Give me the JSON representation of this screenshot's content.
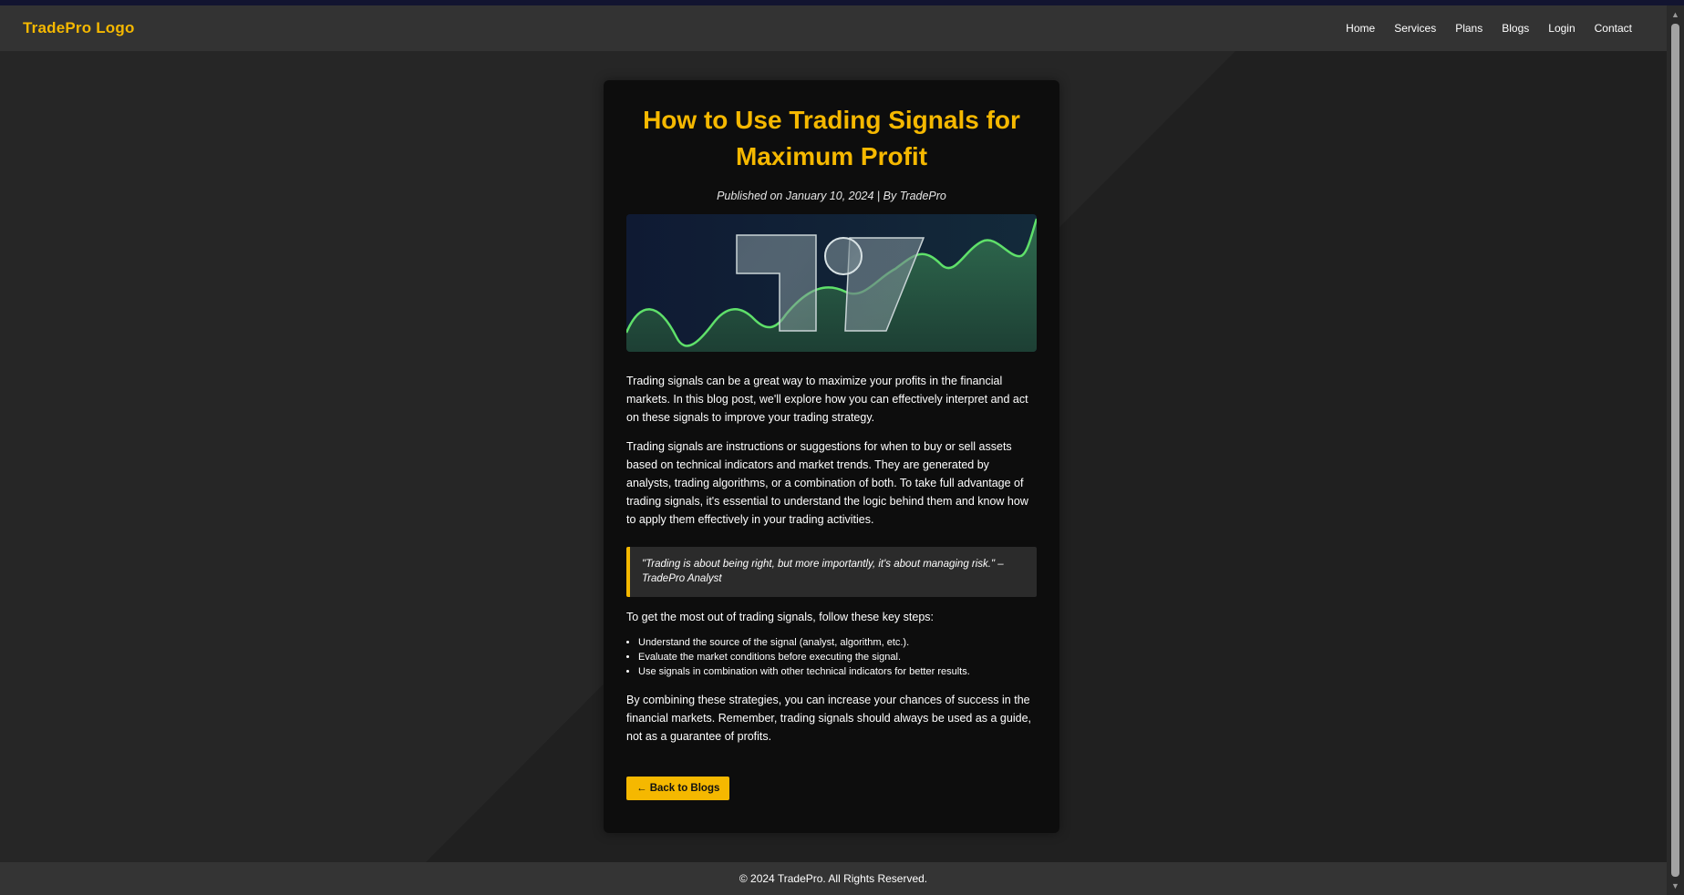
{
  "header": {
    "logo": "TradePro Logo",
    "nav": [
      "Home",
      "Services",
      "Plans",
      "Blogs",
      "Login",
      "Contact"
    ]
  },
  "article": {
    "title": "How to Use Trading Signals for Maximum Profit",
    "meta": "Published on January 10, 2024 | By TradePro",
    "paragraphs": [
      "Trading signals can be a great way to maximize your profits in the financial markets. In this blog post, we'll explore how you can effectively interpret and act on these signals to improve your trading strategy.",
      "Trading signals are instructions or suggestions for when to buy or sell assets based on technical indicators and market trends. They are generated by analysts, trading algorithms, or a combination of both. To take full advantage of trading signals, it's essential to understand the logic behind them and know how to apply them effectively in your trading activities."
    ],
    "quote": "\"Trading is about being right, but more importantly, it's about managing risk.\" – TradePro Analyst",
    "steps_intro": "To get the most out of trading signals, follow these key steps:",
    "steps": [
      "Understand the source of the signal (analyst, algorithm, etc.).",
      "Evaluate the market conditions before executing the signal.",
      "Use signals in combination with other technical indicators for better results."
    ],
    "closing": "By combining these strategies, you can increase your chances of success in the financial markets. Remember, trading signals should always be used as a guide, not as a guarantee of profits.",
    "back_label": "← Back to Blogs"
  },
  "footer": {
    "copyright": "© 2024 TradePro. All Rights Reserved."
  },
  "colors": {
    "accent": "#f5b800",
    "card": "#0d0d0d",
    "header": "#333333",
    "background": "#202020"
  }
}
